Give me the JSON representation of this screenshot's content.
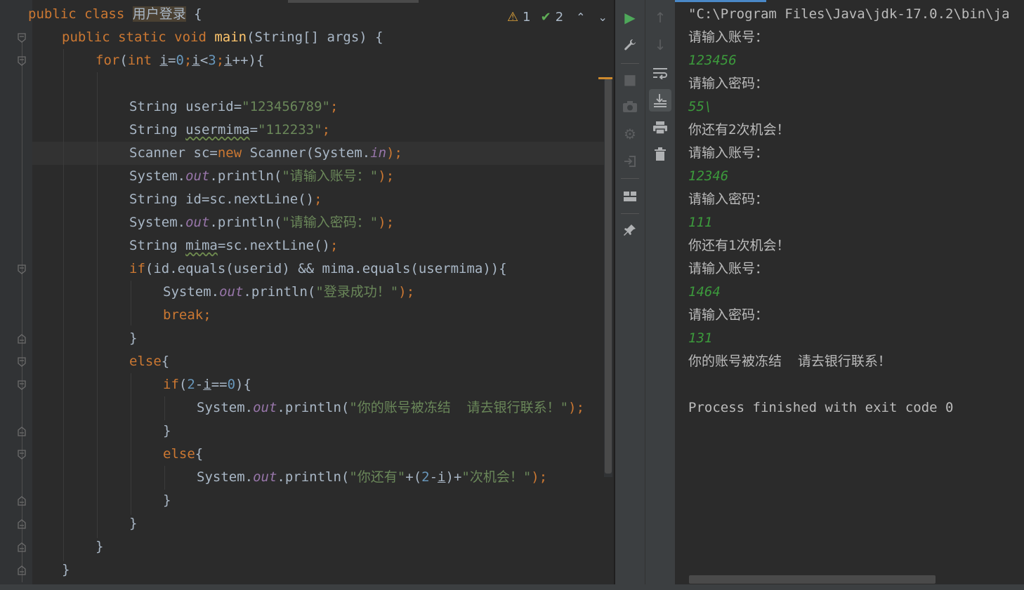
{
  "editor": {
    "inspection": {
      "warnings": "1",
      "ok": "2"
    },
    "code": {
      "l1": {
        "a": "public class ",
        "b": "用户登录",
        "c": " {"
      },
      "l2": {
        "a": "public static void ",
        "b": "main",
        "c": "(String[] args) {"
      },
      "l3": {
        "a": "for",
        "b": "(",
        "c": "int ",
        "d": "i",
        "e": "=",
        "f": "0",
        "g": ";",
        "h": "i",
        "i": "<",
        "j": "3",
        "k": ";",
        "l": "i",
        "m": "++){"
      },
      "l5": {
        "a": "String userid=",
        "b": "\"123456789\"",
        "c": ";"
      },
      "l6": {
        "a": "String ",
        "b": "usermima",
        "c": "=",
        "d": "\"112233\"",
        "e": ";"
      },
      "l7": {
        "a": "Scanner sc=",
        "b": "new ",
        "c": "Scanner(System.",
        "d": "in",
        "e": ");"
      },
      "l8": {
        "a": "System.",
        "b": "out",
        "c": ".println(",
        "d": "\"请输入账号：\"",
        "e": ");"
      },
      "l9": {
        "a": "String id=sc.nextLine()",
        "b": ";"
      },
      "l10": {
        "a": "System.",
        "b": "out",
        "c": ".println(",
        "d": "\"请输入密码：\"",
        "e": ");"
      },
      "l11": {
        "a": "String ",
        "b": "mima",
        "c": "=sc.nextLine()",
        "d": ";"
      },
      "l12": {
        "a": "if",
        "b": "(id.equals(userid) && mima.equals(usermima)){"
      },
      "l13": {
        "a": "System.",
        "b": "out",
        "c": ".println(",
        "d": "\"登录成功！\"",
        "e": ");"
      },
      "l14": {
        "a": "break",
        "b": ";"
      },
      "l15": {
        "a": "}"
      },
      "l16": {
        "a": "else",
        "b": "{"
      },
      "l17": {
        "a": "if",
        "b": "(",
        "c": "2",
        "d": "-",
        "e": "i",
        "f": "==",
        "g": "0",
        "h": "){"
      },
      "l18": {
        "a": "System.",
        "b": "out",
        "c": ".println(",
        "d": "\"你的账号被冻结  请去银行联系！\"",
        "e": ");"
      },
      "l19": {
        "a": "}"
      },
      "l20": {
        "a": "else",
        "b": "{"
      },
      "l21": {
        "a": "System.",
        "b": "out",
        "c": ".println(",
        "d": "\"你还有\"",
        "e": "+(",
        "f": "2",
        "g": "-",
        "h": "i",
        "i": ")+",
        "j": "\"次机会！\"",
        "k": ");"
      },
      "l22": {
        "a": "}"
      },
      "l23": {
        "a": "}"
      },
      "l24": {
        "a": "}"
      },
      "l25": {
        "a": "}"
      }
    }
  },
  "console": {
    "lines": [
      {
        "text": "\"C:\\Program Files\\Java\\jdk-17.0.2\\bin\\ja",
        "kind": "cmd"
      },
      {
        "text": "请输入账号：",
        "kind": "out"
      },
      {
        "text": "123456",
        "kind": "in"
      },
      {
        "text": "请输入密码：",
        "kind": "out"
      },
      {
        "text": "55\\",
        "kind": "in"
      },
      {
        "text": "你还有2次机会！",
        "kind": "out"
      },
      {
        "text": "请输入账号：",
        "kind": "out"
      },
      {
        "text": "12346",
        "kind": "in"
      },
      {
        "text": "请输入密码：",
        "kind": "out"
      },
      {
        "text": "111",
        "kind": "in"
      },
      {
        "text": "你还有1次机会！",
        "kind": "out"
      },
      {
        "text": "请输入账号：",
        "kind": "out"
      },
      {
        "text": "1464",
        "kind": "in"
      },
      {
        "text": "请输入密码：",
        "kind": "out"
      },
      {
        "text": "131",
        "kind": "in"
      },
      {
        "text": "你的账号被冻结  请去银行联系！",
        "kind": "out"
      },
      {
        "text": "",
        "kind": "out"
      },
      {
        "text": "Process finished with exit code 0",
        "kind": "cmd"
      }
    ]
  },
  "toolbar": {
    "left": [
      "rerun-icon",
      "wrench-icon",
      "stop-icon",
      "camera-icon",
      "debug-gear-icon",
      "login-icon",
      "layout-icon",
      "pin-icon"
    ],
    "right": [
      "up-arrow-icon",
      "down-arrow-icon",
      "soft-wrap-icon",
      "scroll-to-end-icon",
      "print-icon",
      "trash-icon"
    ]
  },
  "colors": {
    "keyword": "#cc7832",
    "string": "#6a8759",
    "number": "#6897bb",
    "method": "#ffc66d",
    "static": "#9876aa",
    "console_input": "#3c9a3c",
    "warning": "#e2a53a",
    "ok": "#5fad56"
  }
}
